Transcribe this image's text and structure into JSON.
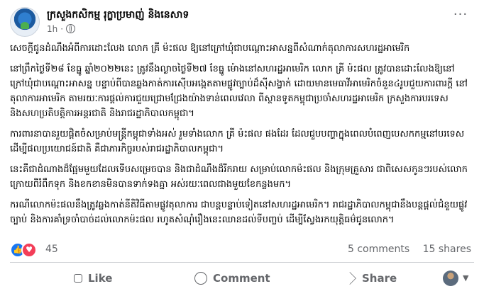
{
  "post": {
    "page_name": "ក្រសួងកសិកម្ម រុក្ខាប្រមាញ់ និងនេសាទ",
    "time": "1h",
    "dot": "·",
    "visibility_icon": "globe-icon",
    "paragraphs": [
      "សេចក្តីជូនដំណឹងអំពីការដោះលែង លោក គ្រី ម៉ះផល ឱ្យនៅក្រៅឃុំជាបណ្តោះអាសន្នពីសំណាក់តុលាការសហរដ្ឋអាមេរិក",
      "នៅព្រឹកថ្ងៃទី២៨ ខែធ្នូ ឆ្នាំ២០២២នេះ ត្រូវនឹងល្ងាចថ្ងៃទី២៧ ខែធ្នូ ម៉ោងនៅសហរដ្ឋអាមេរិក លោក គ្រី ម៉ះផល ត្រូវបានដោះលែងឱ្យនៅក្រៅឃុំជាបណ្តោះអាសន្ន បន្ទាប់ពីបានឆ្លងកាត់ការស៊ើបអង្កេតតាមផ្លូវច្បាប់ដ៏ស៊ីសង្វាក់ ដោយមានមេធាវីអាមេរិកចំនួន៤រូបជួយការពារក្តី នៅតុលាការអាមេរិក តាមរយៈការផ្តល់ការជួយជ្រោមជ្រែងយ៉ាងទាន់ពេលវេលា ពីស្ថានទូតកម្ពុជាប្រចាំសហរដ្ឋអាមេរិក ក្រសួងការបរទេស និងសហប្រតិបត្តិការអន្តរជាតិ និងរាជរដ្ឋាភិបាលកម្ពុជា។",
      "ការពារនាបានរួយផ្តិតចំសម្រាប់មន្ត្រីកម្ពុជាទាំងអស់ រួមទាំងលោក គ្រី ម៉ះផល ផងដែរ ដែលជួបបញ្ហាក្នុងពេលបំពេញបេសកកម្មនៅបរទេសដើម្បីផលប្រយោជន៍ជាតិ គឺជាភារកិច្ចរបស់រាជរដ្ឋាភិបាលកម្ពុជា។",
      "នេះគឺជាដំណាងដ៏ផ្អែមមួយដែលទើបសម្រេចបាន និងជាដំណឹងដ៏រីករាយ សម្រាប់លោកម៉ះផល និងក្រុមគ្រួសារ ជាពិសេសកូនៗរបស់លោក ក្រោយពីរំពឹកទុក និងខកខានមិនបានទាក់ទងគ្នា អស់រយៈពេលជាងមួយខែកន្លងមក។",
      "ករណីលោកម៉ះផលនឹងត្រូវឆ្លងកាត់នីតិវិធីតាមផ្លូវតុលាការ ជាបន្តបន្ទាប់ទៀតនៅសហរដ្ឋអាមេរិក។ រាជរដ្ឋាភិបាលកម្ពុជានឹងបន្តផ្តល់ជំនួយផ្លូវច្បាប់ និងការគាំទ្រចាំបាច់ដល់លោកម៉ះផល រហូតសំណុំរឿងនេះឈានដល់ទីបញ្ចប់ ដើម្បីស្វែងរកយុត្តិធម៌ជូនលោក។"
    ]
  },
  "stats": {
    "reaction_count": "45",
    "comments": "5 comments",
    "shares": "15 shares"
  },
  "actions": {
    "like": "Like",
    "comment": "Comment",
    "share": "Share"
  },
  "colors": {
    "like_blue": "#1877f2",
    "love_red": "#f33e58",
    "muted_text": "#65676b"
  }
}
